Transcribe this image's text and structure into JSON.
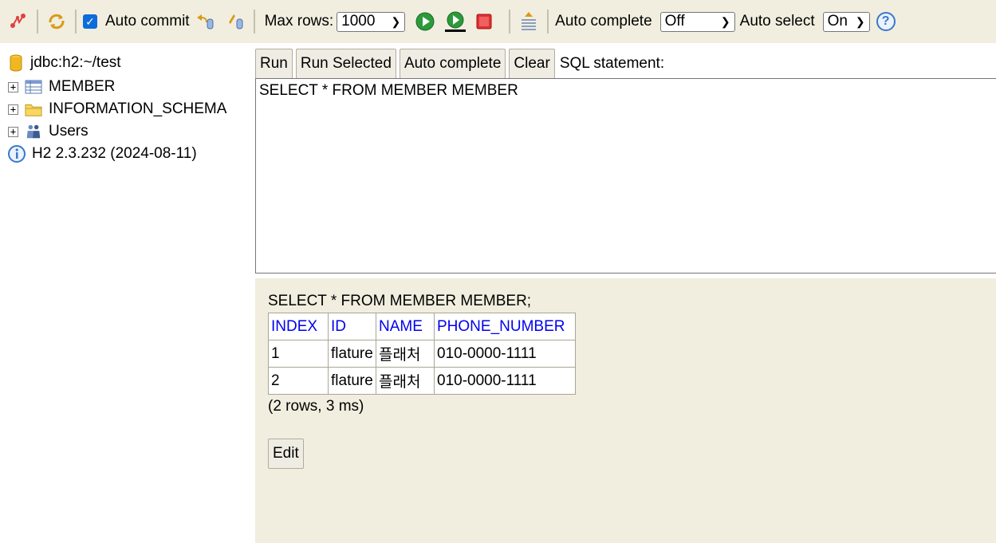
{
  "toolbar": {
    "auto_commit_label": "Auto commit",
    "max_rows_label": "Max rows:",
    "max_rows_value": "1000",
    "auto_complete_label": "Auto complete",
    "auto_complete_value": "Off",
    "auto_select_label": "Auto select",
    "auto_select_value": "On",
    "help_glyph": "?"
  },
  "tree": {
    "connection": "jdbc:h2:~/test",
    "items": [
      {
        "label": "MEMBER",
        "icon": "table-icon"
      },
      {
        "label": "INFORMATION_SCHEMA",
        "icon": "folder-icon"
      },
      {
        "label": "Users",
        "icon": "users-icon"
      }
    ],
    "version": "H2 2.3.232 (2024-08-11)"
  },
  "editor": {
    "buttons": {
      "run": "Run",
      "run_selected": "Run Selected",
      "auto_complete": "Auto complete",
      "clear": "Clear"
    },
    "sql_label": "SQL statement:",
    "sql_text": "SELECT * FROM MEMBER MEMBER"
  },
  "result": {
    "query": "SELECT * FROM MEMBER MEMBER;",
    "columns": [
      "INDEX",
      "ID",
      "NAME",
      "PHONE_NUMBER"
    ],
    "rows": [
      [
        "1",
        "flature",
        "플래처",
        "010-0000-1111"
      ],
      [
        "2",
        "flature",
        "플래처",
        "010-0000-1111"
      ]
    ],
    "status": "(2 rows, 3 ms)",
    "edit_label": "Edit"
  },
  "colors": {
    "toolbar_bg": "#f1eedf",
    "link": "#0000ee",
    "accent": "#0b6cda"
  }
}
